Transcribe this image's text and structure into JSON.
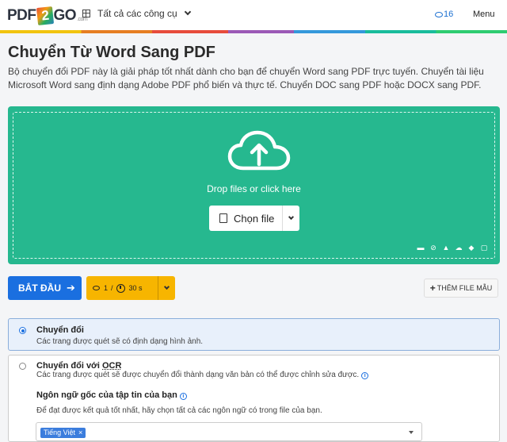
{
  "header": {
    "logo_pdf": "PDF",
    "logo_two": "2",
    "logo_go": "GO",
    "logo_com": ".com",
    "tools_label": "Tất cả các công cụ",
    "credits": "16",
    "menu_label": "Menu"
  },
  "page": {
    "title": "Chuyển Từ Word Sang PDF",
    "description": "Bộ chuyển đổi PDF này là giải pháp tốt nhất dành cho bạn để chuyển Word sang PDF trực tuyến. Chuyển tài liệu Microsoft Word sang định dạng Adobe PDF phổ biến và thực tế. Chuyển DOC sang PDF hoặc DOCX sang PDF."
  },
  "dropzone": {
    "drop_text": "Drop files or click here",
    "choose_label": "Chọn file",
    "sources": [
      "folder-icon",
      "link-icon",
      "google-drive-icon",
      "onedrive-icon",
      "dropbox-icon",
      "clipboard-icon"
    ]
  },
  "actions": {
    "start_label": "BẮT ĐẦU",
    "cost_credits": "1",
    "cost_separator": "/",
    "cost_time": "30 s",
    "sample_label": "THÊM FILE MẪU"
  },
  "options": {
    "convert": {
      "title": "Chuyển đổi",
      "subtitle": "Các trang được quét sẽ có định dạng hình ảnh.",
      "selected": true
    },
    "convert_ocr": {
      "title_prefix": "Chuyển đổi với ",
      "title_ocr": "OCR",
      "subtitle": "Các trang được quét sẽ được chuyển đổi thành dạng văn bản có thể được chỉnh sửa được.",
      "selected": false,
      "lang_label": "Ngôn ngữ gốc của tập tin của bạn",
      "lang_hint": "Để đạt được kết quả tốt nhất, hãy chọn tất cả các ngôn ngữ có trong file của bạn.",
      "selected_language": "Tiếng Việt"
    }
  },
  "colors": {
    "accent": "#1a6fe0",
    "dropzone": "#26b88f",
    "cost": "#f7b500"
  }
}
